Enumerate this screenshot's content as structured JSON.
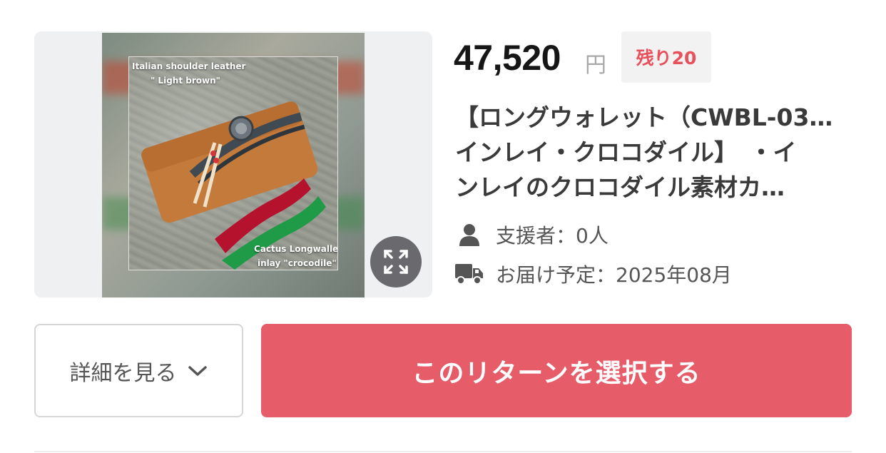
{
  "product": {
    "image": {
      "caption_top_1": "Italian shoulder leather",
      "caption_top_2": "\" Light brown\"",
      "caption_bottom_1": "Cactus Longwallet",
      "caption_bottom_2": "inlay \"crocodile\""
    },
    "price": "47,520",
    "currency": "円",
    "remaining_badge": "残り20",
    "title_line_1": "【ロングウォレット（CWBL-03…",
    "title_line_2": "インレイ・クロコダイル】　・イ",
    "title_line_3": "ンレイのクロコダイル素材カ…",
    "supporters": "支援者：0人",
    "delivery": "お届け予定：2025年08月"
  },
  "actions": {
    "detail_label": "詳細を見る",
    "select_label": "このリターンを選択する"
  },
  "colors": {
    "accent": "#e65c69",
    "badge_text": "#e8505b"
  },
  "icons": {
    "expand": "expand-icon",
    "person": "person-icon",
    "truck": "truck-icon",
    "chevron": "chevron-down-icon"
  }
}
